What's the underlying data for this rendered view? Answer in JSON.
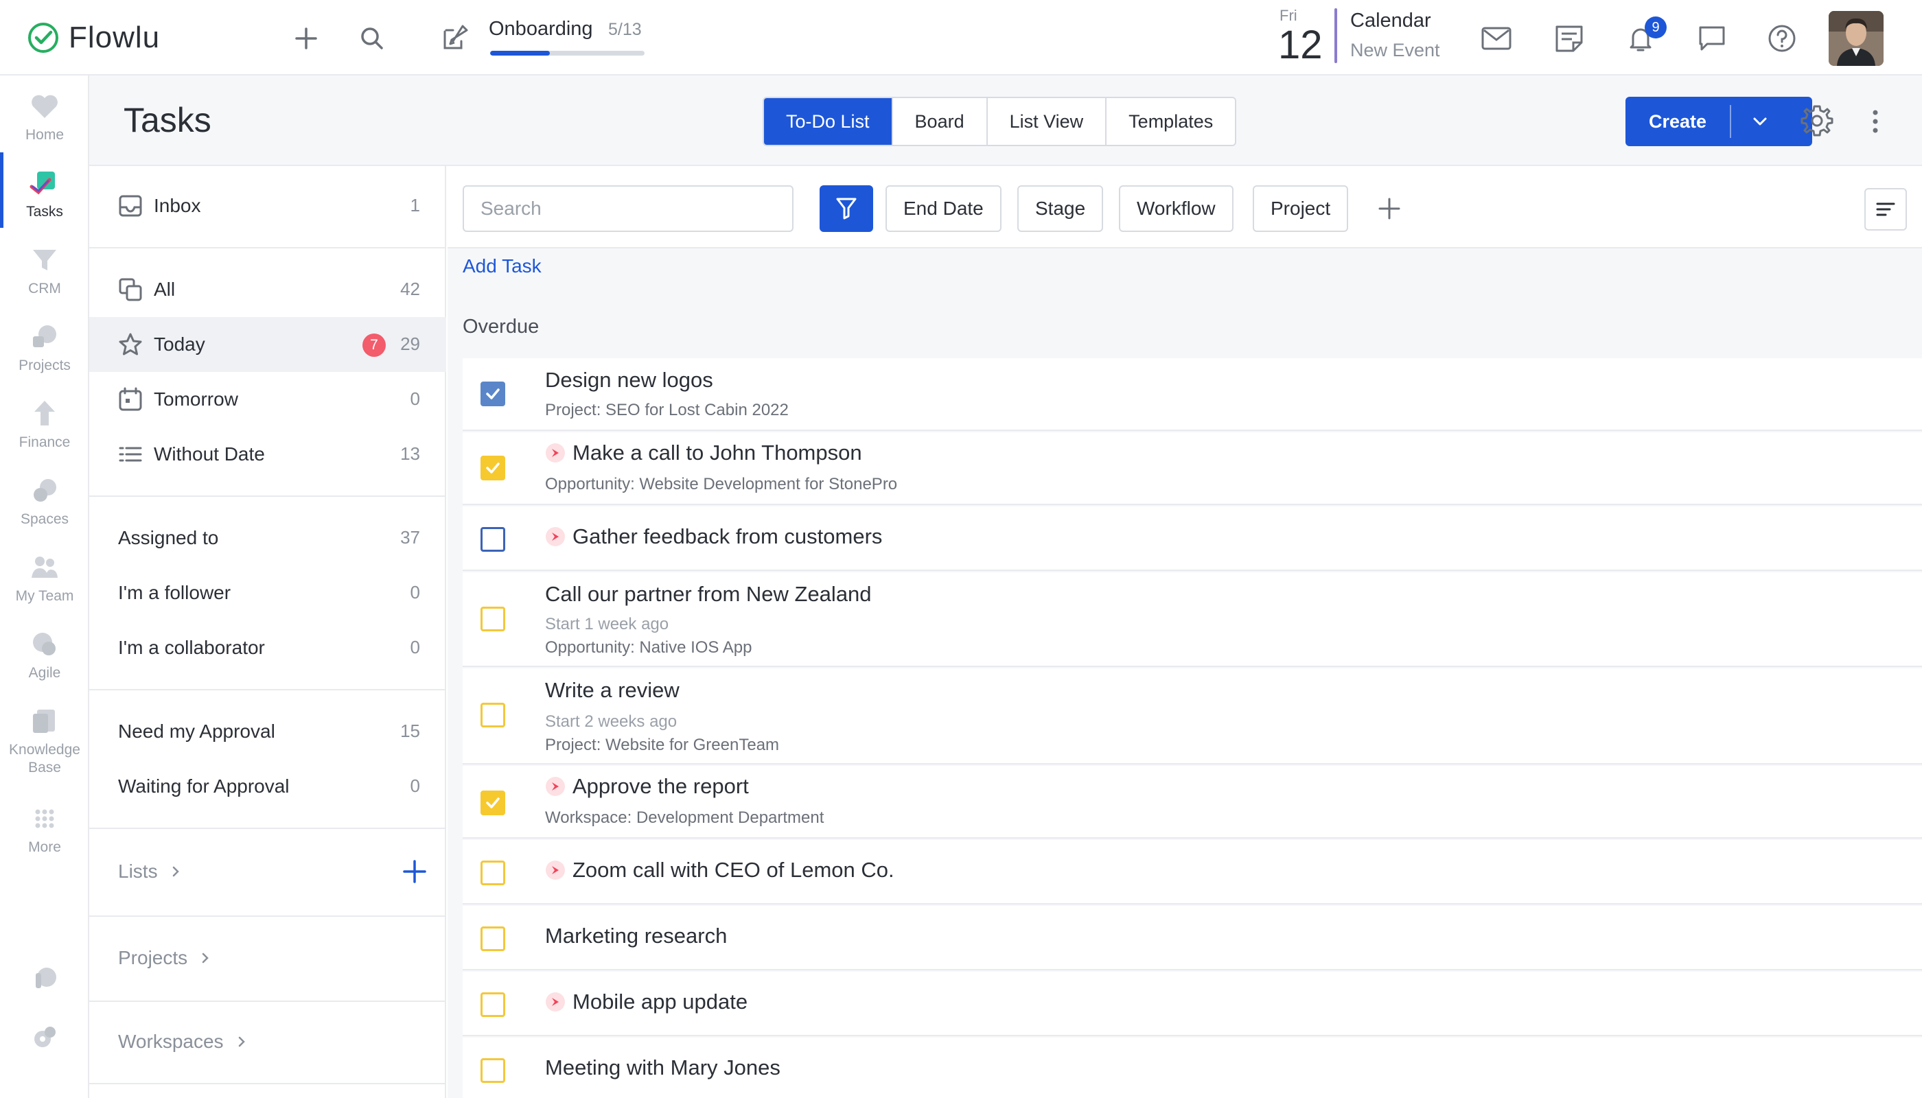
{
  "app": {
    "logo_text": "Flowlu",
    "onboarding": {
      "title": "Onboarding",
      "count": "5/13",
      "progress": 0.385
    },
    "calendar": {
      "day_name": "Fri",
      "day_number": "12",
      "title": "Calendar",
      "subtitle": "New Event"
    },
    "notifications_count": "9",
    "colors": {
      "accent": "#1d57d8",
      "overdue_badge": "#f25c6b",
      "checkbox_yellow": "#f6c92e",
      "checkbox_blue": "#5a86c9"
    }
  },
  "rail": {
    "items": [
      {
        "label": "Home",
        "icon": "heart-icon"
      },
      {
        "label": "Tasks",
        "icon": "tasks-icon",
        "active": true
      },
      {
        "label": "CRM",
        "icon": "funnel-icon"
      },
      {
        "label": "Projects",
        "icon": "projects-icon"
      },
      {
        "label": "Finance",
        "icon": "finance-icon"
      },
      {
        "label": "Spaces",
        "icon": "spaces-icon"
      },
      {
        "label": "My Team",
        "icon": "team-icon"
      },
      {
        "label": "Agile",
        "icon": "agile-icon"
      },
      {
        "label": "Knowledge Base",
        "icon": "book-icon"
      },
      {
        "label": "More",
        "icon": "grid-icon"
      }
    ]
  },
  "header": {
    "title": "Tasks",
    "tabs": [
      "To-Do List",
      "Board",
      "List View",
      "Templates"
    ],
    "active_tab": "To-Do List",
    "create_label": "Create"
  },
  "filters": {
    "inbox": {
      "label": "Inbox",
      "count": "1"
    },
    "all": {
      "label": "All",
      "count": "42"
    },
    "today": {
      "label": "Today",
      "count": "29",
      "overdue": "7"
    },
    "tomorrow": {
      "label": "Tomorrow",
      "count": "0"
    },
    "without_date": {
      "label": "Without Date",
      "count": "13"
    },
    "assigned_to": {
      "label": "Assigned to",
      "count": "37"
    },
    "follower": {
      "label": "I'm a follower",
      "count": "0"
    },
    "collaborator": {
      "label": "I'm a collaborator",
      "count": "0"
    },
    "need_approval": {
      "label": "Need my Approval",
      "count": "15"
    },
    "waiting_approval": {
      "label": "Waiting for Approval",
      "count": "0"
    },
    "lists_label": "Lists",
    "projects_label": "Projects",
    "workspaces_label": "Workspaces"
  },
  "toolbar": {
    "search_placeholder": "Search",
    "chips": [
      "End Date",
      "Stage",
      "Workflow",
      "Project"
    ]
  },
  "tasks": {
    "add_label": "Add Task",
    "group_title": "Overdue",
    "items": [
      {
        "title": "Design new logos",
        "line1": "Project: SEO for Lost Cabin 2022",
        "checked": true,
        "color": "blue",
        "priority": false
      },
      {
        "title": "Make a call to John Thompson",
        "line1": "Opportunity: Website Development for StonePro",
        "checked": true,
        "color": "yellow",
        "priority": true
      },
      {
        "title": "Gather feedback from customers",
        "checked": false,
        "color": "blue",
        "priority": true
      },
      {
        "title": "Call our partner from New Zealand",
        "line0": "Start 1 week ago",
        "line1": "Opportunity: Native IOS App",
        "checked": false,
        "color": "yellow",
        "priority": false
      },
      {
        "title": "Write a review",
        "line0": "Start 2 weeks ago",
        "line1": "Project: Website for GreenTeam",
        "checked": false,
        "color": "yellow",
        "priority": false
      },
      {
        "title": "Approve the report",
        "line1": "Workspace: Development Department",
        "checked": true,
        "color": "yellow",
        "priority": true
      },
      {
        "title": "Zoom call with CEO of Lemon Co.",
        "checked": false,
        "color": "yellow",
        "priority": true
      },
      {
        "title": "Marketing research",
        "checked": false,
        "color": "yellow",
        "priority": false
      },
      {
        "title": "Mobile app update",
        "checked": false,
        "color": "yellow",
        "priority": true
      },
      {
        "title": "Meeting with Mary Jones",
        "checked": false,
        "color": "yellow",
        "priority": false
      }
    ]
  }
}
